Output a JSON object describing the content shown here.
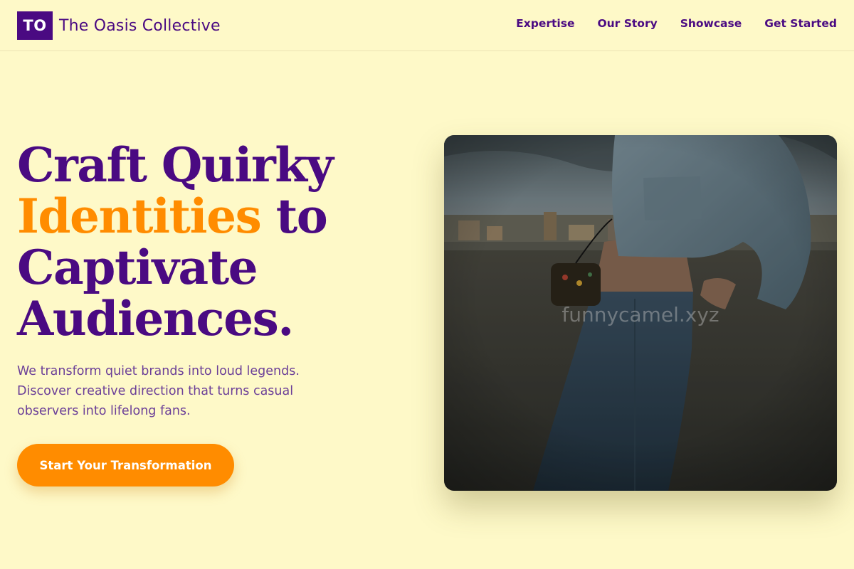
{
  "brand": {
    "logo_initials": "TO",
    "name": "The Oasis Collective"
  },
  "nav": {
    "items": [
      {
        "label": "Expertise"
      },
      {
        "label": "Our Story"
      },
      {
        "label": "Showcase"
      },
      {
        "label": "Get Started"
      }
    ]
  },
  "hero": {
    "headline_line1": "Craft Quirky",
    "headline_accent": "Identities",
    "headline_line2_rest": "to",
    "headline_line3": "Captivate",
    "headline_line4": "Audiences.",
    "description": "We transform quiet brands into loud legends. Discover creative direction that turns casual observers into lifelong fans.",
    "cta_label": "Start Your Transformation",
    "image_watermark": "funnycamel.xyz"
  },
  "colors": {
    "background": "#fef9c8",
    "primary": "#4a0a82",
    "accent": "#ff8c00"
  }
}
